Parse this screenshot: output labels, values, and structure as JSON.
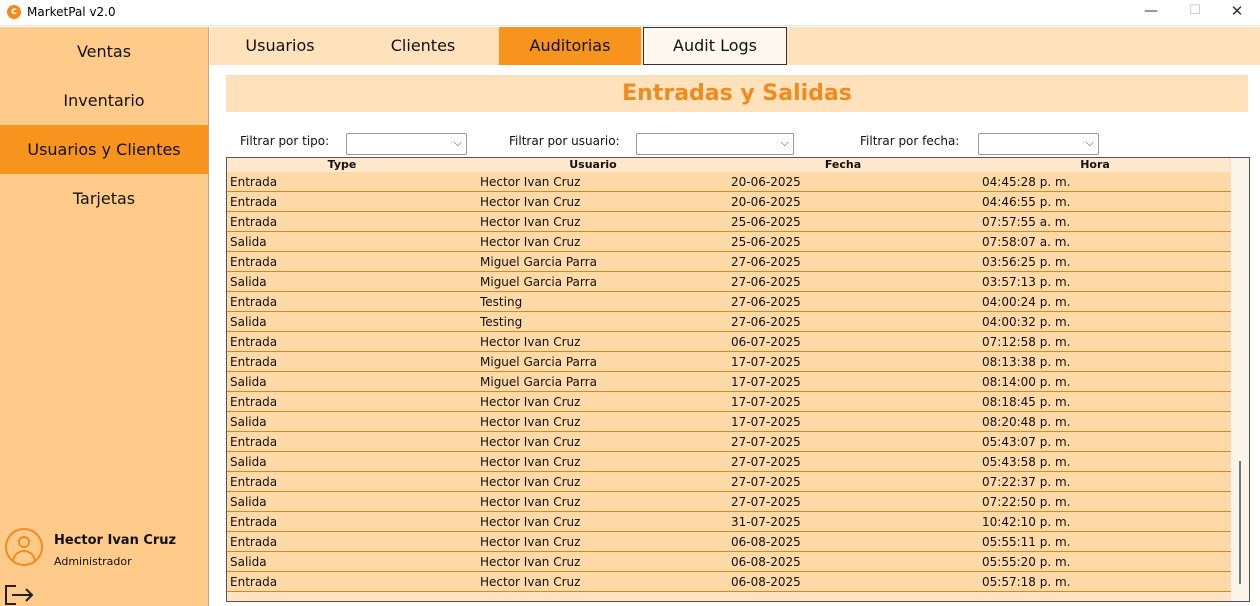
{
  "window": {
    "title": "MarketPal v2.0",
    "icon": "marketpal-logo-icon",
    "controls": {
      "minimize": "—",
      "maximize": "☐",
      "close": "✕"
    }
  },
  "sidebar": {
    "items": [
      {
        "label": "Ventas"
      },
      {
        "label": "Inventario"
      },
      {
        "label": "Usuarios y Clientes"
      },
      {
        "label": "Tarjetas"
      }
    ],
    "active_index": 2,
    "user": {
      "name": "Hector Ivan Cruz",
      "role": "Administrador"
    }
  },
  "tabs": [
    {
      "label": "Usuarios"
    },
    {
      "label": "Clientes"
    },
    {
      "label": "Auditorias"
    },
    {
      "label": "Audit Logs"
    }
  ],
  "main": {
    "title": "Entradas y Salidas",
    "filters": {
      "type_label": "Filtrar por tipo:",
      "user_label": "Filtrar por usuario:",
      "date_label": "Filtrar por fecha:"
    },
    "table": {
      "columns": [
        "Type",
        "Usuario",
        "Fecha",
        "Hora"
      ],
      "rows": [
        [
          "Entrada",
          "Hector Ivan Cruz",
          "20-06-2025",
          "04:45:28 p. m."
        ],
        [
          "Entrada",
          "Hector Ivan Cruz",
          "20-06-2025",
          "04:46:55 p. m."
        ],
        [
          "Entrada",
          "Hector Ivan Cruz",
          "25-06-2025",
          "07:57:55 a. m."
        ],
        [
          "Salida",
          "Hector Ivan Cruz",
          "25-06-2025",
          "07:58:07 a. m."
        ],
        [
          "Entrada",
          "Miguel Garcia Parra",
          "27-06-2025",
          "03:56:25 p. m."
        ],
        [
          "Salida",
          "Miguel Garcia Parra",
          "27-06-2025",
          "03:57:13 p. m."
        ],
        [
          "Entrada",
          "Testing",
          "27-06-2025",
          "04:00:24 p. m."
        ],
        [
          "Salida",
          "Testing",
          "27-06-2025",
          "04:00:32 p. m."
        ],
        [
          "Entrada",
          "Hector Ivan Cruz",
          "06-07-2025",
          "07:12:58 p. m."
        ],
        [
          "Entrada",
          "Miguel Garcia Parra",
          "17-07-2025",
          "08:13:38 p. m."
        ],
        [
          "Salida",
          "Miguel Garcia Parra",
          "17-07-2025",
          "08:14:00 p. m."
        ],
        [
          "Entrada",
          "Hector Ivan Cruz",
          "17-07-2025",
          "08:18:45 p. m."
        ],
        [
          "Salida",
          "Hector Ivan Cruz",
          "17-07-2025",
          "08:20:48 p. m."
        ],
        [
          "Entrada",
          "Hector Ivan Cruz",
          "27-07-2025",
          "05:43:07 p. m."
        ],
        [
          "Salida",
          "Hector Ivan Cruz",
          "27-07-2025",
          "05:43:58 p. m."
        ],
        [
          "Entrada",
          "Hector Ivan Cruz",
          "27-07-2025",
          "07:22:37 p. m."
        ],
        [
          "Salida",
          "Hector Ivan Cruz",
          "27-07-2025",
          "07:22:50 p. m."
        ],
        [
          "Entrada",
          "Hector Ivan Cruz",
          "31-07-2025",
          "10:42:10 p. m."
        ],
        [
          "Entrada",
          "Hector Ivan Cruz",
          "06-08-2025",
          "05:55:11 p. m."
        ],
        [
          "Salida",
          "Hector Ivan Cruz",
          "06-08-2025",
          "05:55:20 p. m."
        ],
        [
          "Entrada",
          "Hector Ivan Cruz",
          "06-08-2025",
          "05:57:18 p. m."
        ]
      ]
    }
  },
  "colors": {
    "accent": "#f7941e",
    "sidebar_bg": "#ffcb8a",
    "tab_bar_bg": "#ffe1bc",
    "title_text": "#f08c1e",
    "row_bg": "#ffd9a8",
    "row_border": "#d48a1a"
  }
}
